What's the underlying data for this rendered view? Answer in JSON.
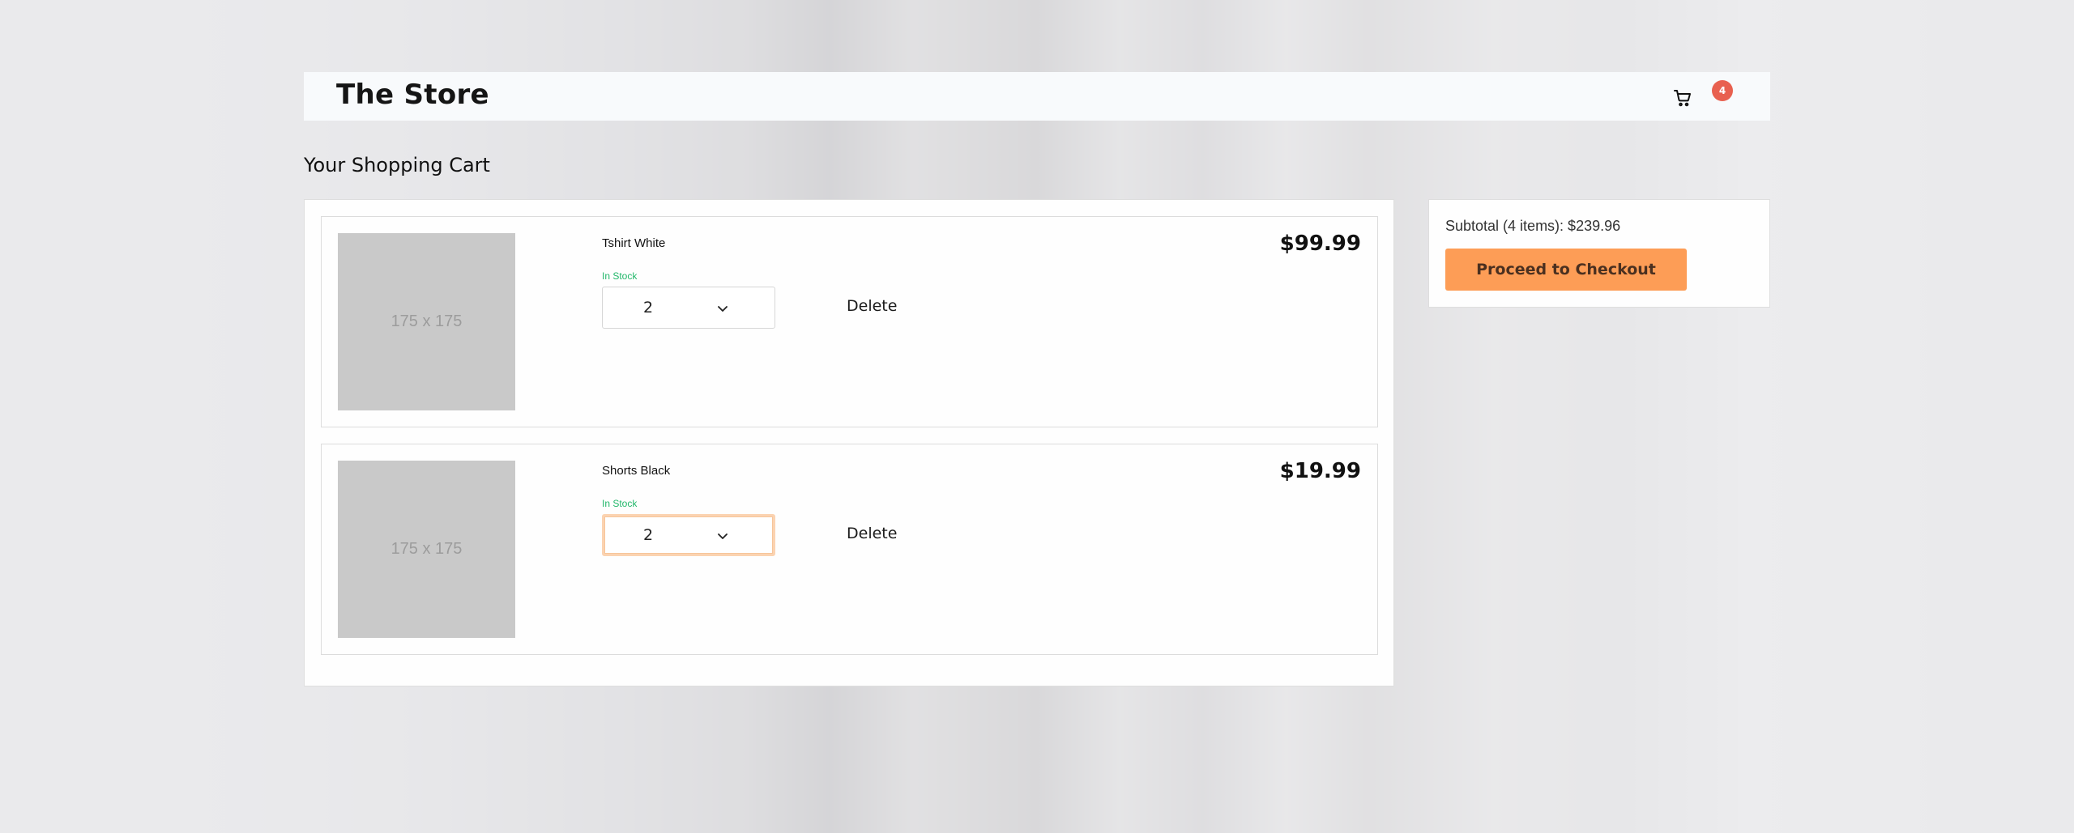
{
  "header": {
    "logo": "The Store",
    "cart_icon": "cart-icon",
    "cart_count": "4"
  },
  "page": {
    "title": "Your Shopping Cart"
  },
  "cart": {
    "items": [
      {
        "thumbnail_text": "175 x 175",
        "name": "Tshirt White",
        "stock": "In Stock",
        "quantity": "2",
        "delete_label": "Delete",
        "price": "$99.99"
      },
      {
        "thumbnail_text": "175 x 175",
        "name": "Shorts Black",
        "stock": "In Stock",
        "quantity": "2",
        "delete_label": "Delete",
        "price": "$19.99"
      }
    ]
  },
  "summary": {
    "subtotal": "Subtotal (4 items): $239.96",
    "checkout_label": "Proceed to Checkout"
  },
  "colors": {
    "accent": "#fd9d56",
    "badge": "#e8604f",
    "in_stock": "#22b76a",
    "header_bg": "#f8fafc"
  }
}
